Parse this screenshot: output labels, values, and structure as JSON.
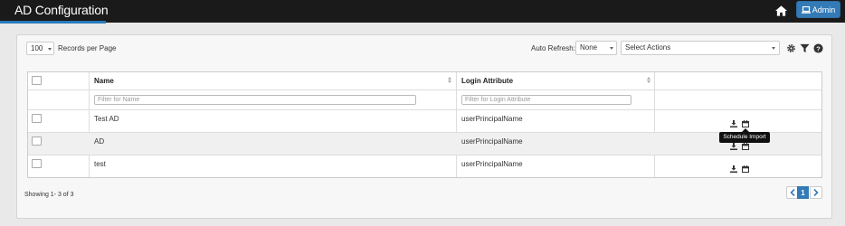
{
  "header": {
    "title": "AD Configuration",
    "user_button_label": "Admin",
    "home_icon": "home-icon",
    "user_icon": "laptop-icon",
    "accent_color": "#2a7ab8"
  },
  "toolbar": {
    "records_per_page_value": "100",
    "records_per_page_label": "Records per Page",
    "auto_refresh_label": "Auto Refresh:",
    "auto_refresh_value": "None",
    "actions_placeholder": "Select Actions",
    "icons": [
      "gear-icon",
      "filter-icon",
      "help-icon"
    ]
  },
  "table": {
    "columns": [
      "Name",
      "Login Attribute"
    ],
    "filter_placeholders": [
      "Filter for Name",
      "Filter for Login Attribute"
    ],
    "rows": [
      {
        "name": "Test AD",
        "login_attribute": "userPrincipalName"
      },
      {
        "name": "AD",
        "login_attribute": "userPrincipalName"
      },
      {
        "name": "test",
        "login_attribute": "userPrincipalName"
      }
    ],
    "row_action_icons": [
      "download-icon",
      "calendar-icon"
    ]
  },
  "tooltip": {
    "text": "Schedule Import"
  },
  "footer": {
    "showing_text": "Showing 1- 3 of 3",
    "current_page": "1"
  }
}
